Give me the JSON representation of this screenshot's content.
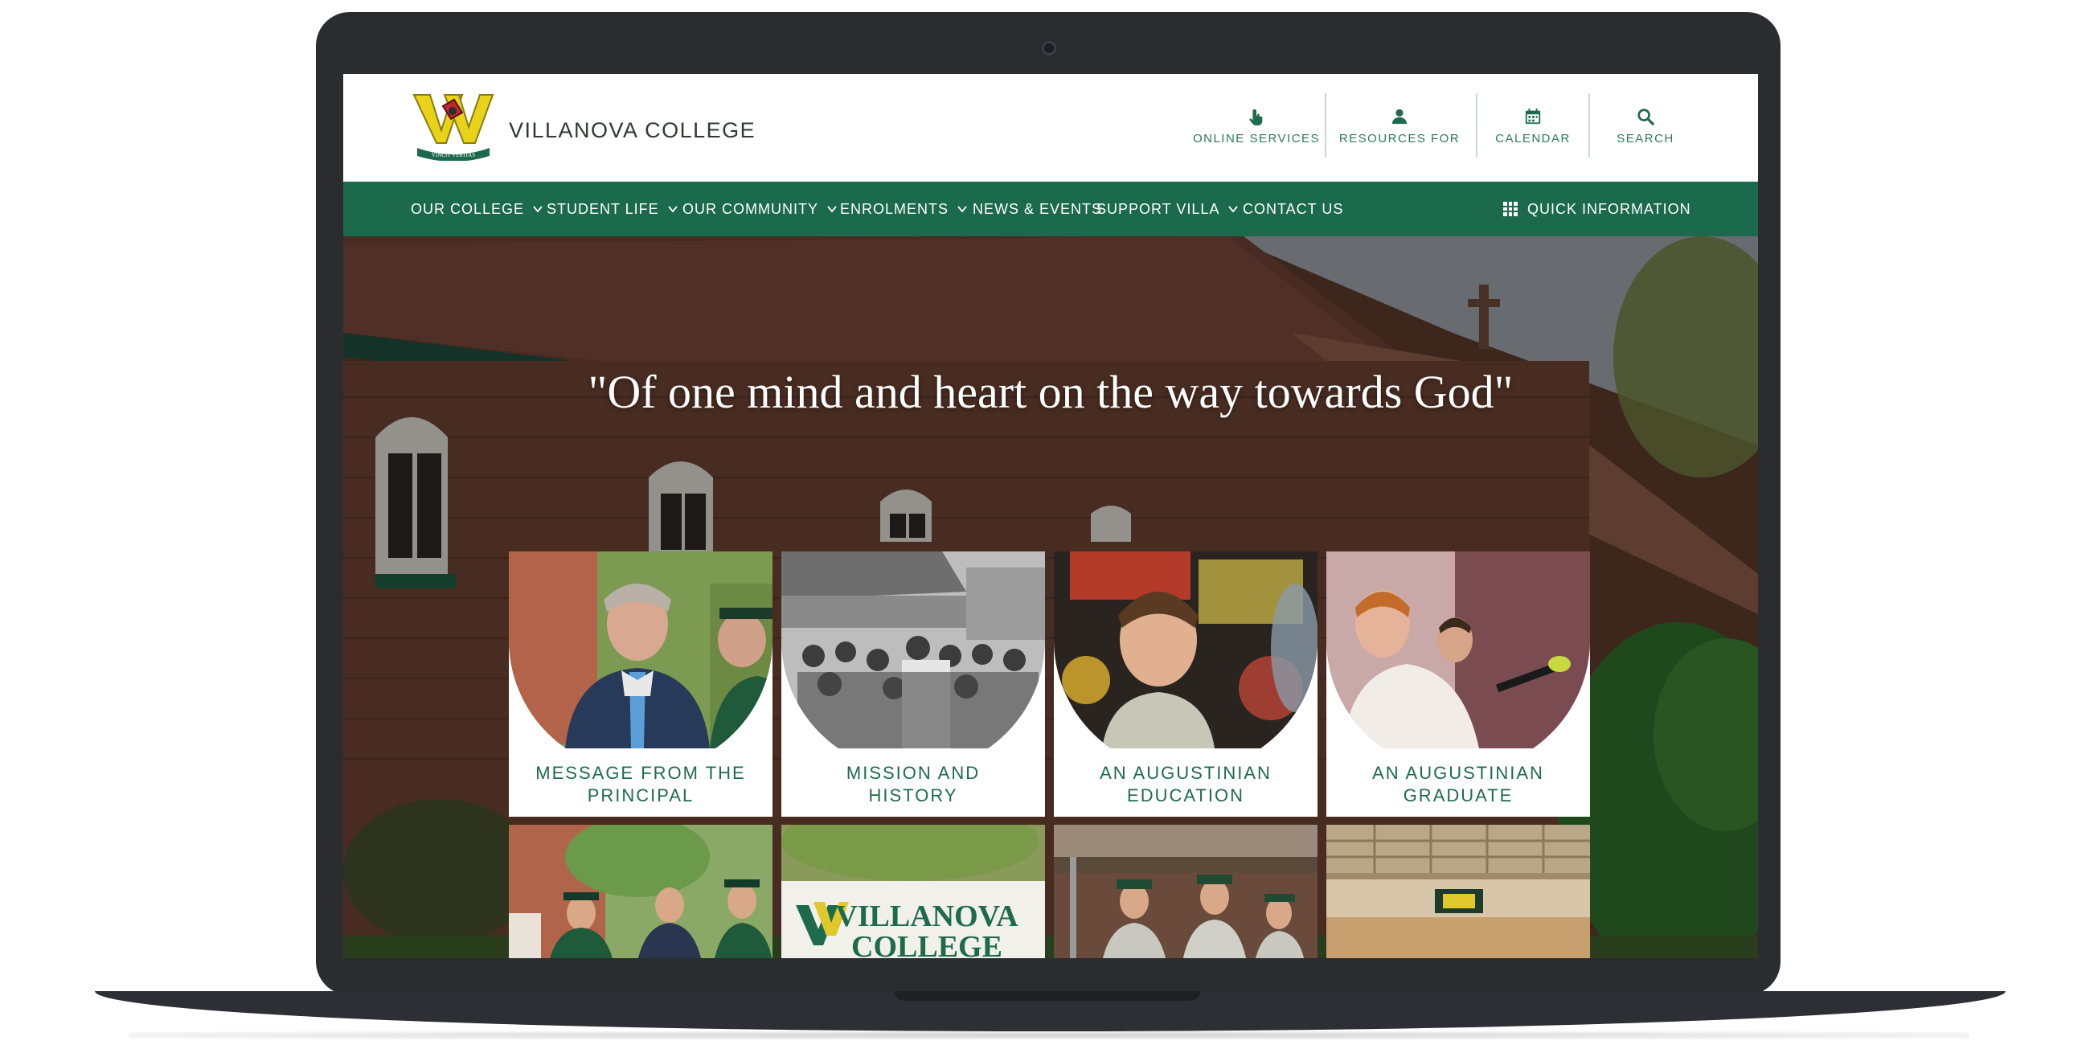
{
  "brand": {
    "name": "VILLANOVA COLLEGE",
    "motto": "VINCIT VERITAS"
  },
  "utility_nav": [
    {
      "label": "ONLINE SERVICES",
      "icon": "hand-pointer-icon"
    },
    {
      "label": "RESOURCES FOR",
      "icon": "person-icon"
    },
    {
      "label": "CALENDAR",
      "icon": "calendar-icon"
    },
    {
      "label": "SEARCH",
      "icon": "search-icon"
    }
  ],
  "main_nav": [
    {
      "label": "OUR COLLEGE",
      "has_dropdown": true
    },
    {
      "label": "STUDENT LIFE",
      "has_dropdown": true
    },
    {
      "label": "OUR COMMUNITY",
      "has_dropdown": true
    },
    {
      "label": "ENROLMENTS",
      "has_dropdown": true
    },
    {
      "label": "NEWS & EVENTS",
      "has_dropdown": false
    },
    {
      "label": "SUPPORT VILLA",
      "has_dropdown": true
    },
    {
      "label": "CONTACT US",
      "has_dropdown": false
    }
  ],
  "quick_information": {
    "label": "QUICK INFORMATION",
    "icon": "grid-icon"
  },
  "hero": {
    "quote": "\"Of one mind and heart on the way towards God\""
  },
  "cards": [
    {
      "title": "MESSAGE FROM THE PRINCIPAL"
    },
    {
      "title": "MISSION AND HISTORY"
    },
    {
      "title": "AN AUGUSTINIAN EDUCATION"
    },
    {
      "title": "AN AUGUSTINIAN GRADUATE"
    }
  ],
  "lower_cards": {
    "sign_line1": "VILLANOVA",
    "sign_line2": "COLLEGE"
  },
  "colors": {
    "brand_green": "#1b6a4d",
    "accent_gold": "#e8d21a",
    "accent_red": "#c0262d"
  }
}
